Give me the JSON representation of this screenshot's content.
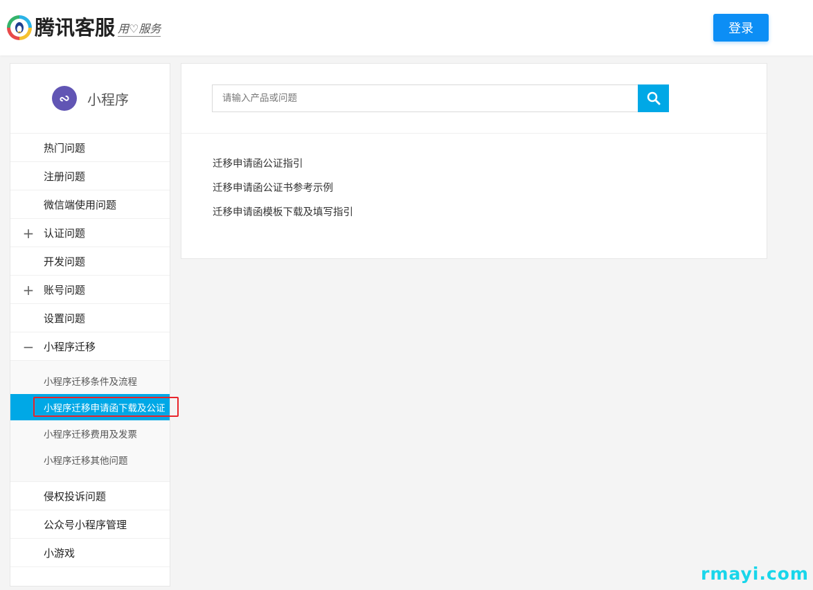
{
  "header": {
    "logo_text": "腾讯客服",
    "logo_slogan": "用♡服务",
    "login_label": "登录"
  },
  "sidebar": {
    "title": "小程序",
    "items": [
      {
        "label": "热门问题",
        "toggle": ""
      },
      {
        "label": "注册问题",
        "toggle": ""
      },
      {
        "label": "微信端使用问题",
        "toggle": ""
      },
      {
        "label": "认证问题",
        "toggle": "+"
      },
      {
        "label": "开发问题",
        "toggle": ""
      },
      {
        "label": "账号问题",
        "toggle": "+"
      },
      {
        "label": "设置问题",
        "toggle": ""
      },
      {
        "label": "小程序迁移",
        "toggle": "−"
      }
    ],
    "subitems": [
      {
        "label": "小程序迁移条件及流程"
      },
      {
        "label": "小程序迁移申请函下载及公证"
      },
      {
        "label": "小程序迁移费用及发票"
      },
      {
        "label": "小程序迁移其他问题"
      }
    ],
    "items_after": [
      {
        "label": "侵权投诉问题"
      },
      {
        "label": "公众号小程序管理"
      },
      {
        "label": "小游戏"
      }
    ]
  },
  "search": {
    "placeholder": "请输入产品或问题",
    "value": ""
  },
  "articles": [
    {
      "title": "迁移申请函公证指引"
    },
    {
      "title": "迁移申请函公证书参考示例"
    },
    {
      "title": "迁移申请函模板下载及填写指引"
    }
  ],
  "watermark": "rmayi.com",
  "colors": {
    "accent": "#00a8e6",
    "login_button": "#0c8ef5",
    "miniprogram_icon": "#6155b4",
    "highlight_outline": "#e8242a"
  }
}
